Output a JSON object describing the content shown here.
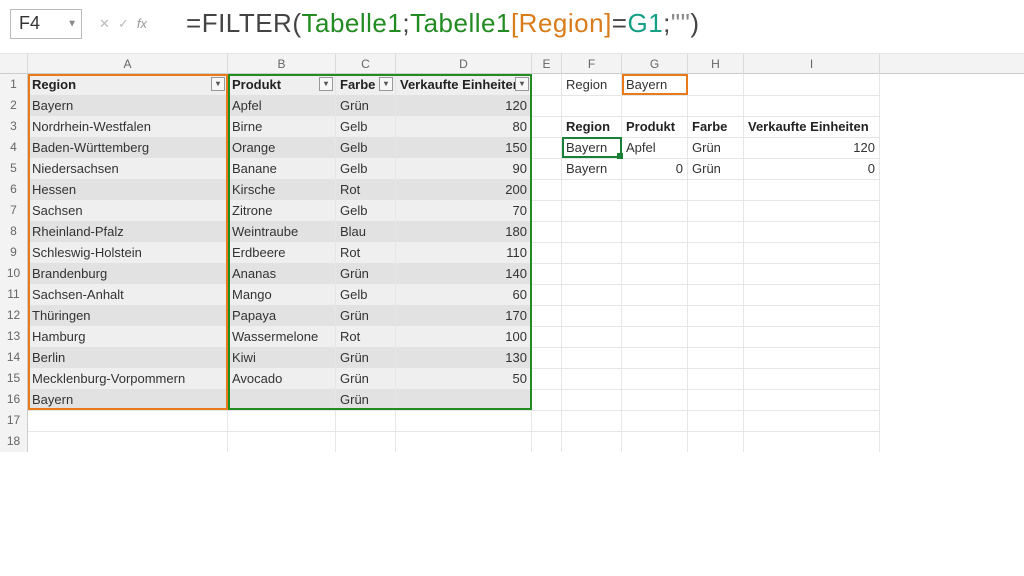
{
  "active_cell": "F4",
  "formula": {
    "prefix": "=",
    "fn": "FILTER",
    "arg1": "Tabelle1",
    "arg2a": "Tabelle1",
    "arg2b": "[Region]",
    "arg2c": "=",
    "arg2d": "G1",
    "arg3": "\"\""
  },
  "columns": [
    "A",
    "B",
    "C",
    "D",
    "E",
    "F",
    "G",
    "H",
    "I"
  ],
  "table1": {
    "headers": [
      "Region",
      "Produkt",
      "Farbe",
      "Verkaufte Einheiten"
    ],
    "rows": [
      [
        "Bayern",
        "Apfel",
        "Grün",
        "120"
      ],
      [
        "Nordrhein-Westfalen",
        "Birne",
        "Gelb",
        "80"
      ],
      [
        "Baden-Württemberg",
        "Orange",
        "Gelb",
        "150"
      ],
      [
        "Niedersachsen",
        "Banane",
        "Gelb",
        "90"
      ],
      [
        "Hessen",
        "Kirsche",
        "Rot",
        "200"
      ],
      [
        "Sachsen",
        "Zitrone",
        "Gelb",
        "70"
      ],
      [
        "Rheinland-Pfalz",
        "Weintraube",
        "Blau",
        "180"
      ],
      [
        "Schleswig-Holstein",
        "Erdbeere",
        "Rot",
        "110"
      ],
      [
        "Brandenburg",
        "Ananas",
        "Grün",
        "140"
      ],
      [
        "Sachsen-Anhalt",
        "Mango",
        "Gelb",
        "60"
      ],
      [
        "Thüringen",
        "Papaya",
        "Grün",
        "170"
      ],
      [
        "Hamburg",
        "Wassermelone",
        "Rot",
        "100"
      ],
      [
        "Berlin",
        "Kiwi",
        "Grün",
        "130"
      ],
      [
        "Mecklenburg-Vorpommern",
        "Avocado",
        "Grün",
        "50"
      ],
      [
        "Bayern",
        "",
        "Grün",
        ""
      ]
    ]
  },
  "criteria": {
    "label": "Region",
    "value": "Bayern"
  },
  "result": {
    "headers": [
      "Region",
      "Produkt",
      "Farbe",
      "Verkaufte Einheiten"
    ],
    "rows": [
      [
        "Bayern",
        "Apfel",
        "Grün",
        "120"
      ],
      [
        "Bayern",
        "0",
        "Grün",
        "0"
      ]
    ]
  },
  "chart_data": {
    "type": "table",
    "title": "Tabelle1 — Verkaufte Einheiten nach Region",
    "columns": [
      "Region",
      "Produkt",
      "Farbe",
      "Verkaufte Einheiten"
    ],
    "rows": [
      [
        "Bayern",
        "Apfel",
        "Grün",
        120
      ],
      [
        "Nordrhein-Westfalen",
        "Birne",
        "Gelb",
        80
      ],
      [
        "Baden-Württemberg",
        "Orange",
        "Gelb",
        150
      ],
      [
        "Niedersachsen",
        "Banane",
        "Gelb",
        90
      ],
      [
        "Hessen",
        "Kirsche",
        "Rot",
        200
      ],
      [
        "Sachsen",
        "Zitrone",
        "Gelb",
        70
      ],
      [
        "Rheinland-Pfalz",
        "Weintraube",
        "Blau",
        180
      ],
      [
        "Schleswig-Holstein",
        "Erdbeere",
        "Rot",
        110
      ],
      [
        "Brandenburg",
        "Ananas",
        "Grün",
        140
      ],
      [
        "Sachsen-Anhalt",
        "Mango",
        "Gelb",
        60
      ],
      [
        "Thüringen",
        "Papaya",
        "Grün",
        170
      ],
      [
        "Hamburg",
        "Wassermelone",
        "Rot",
        100
      ],
      [
        "Berlin",
        "Kiwi",
        "Grün",
        130
      ],
      [
        "Mecklenburg-Vorpommern",
        "Avocado",
        "Grün",
        50
      ],
      [
        "Bayern",
        null,
        "Grün",
        null
      ]
    ]
  }
}
